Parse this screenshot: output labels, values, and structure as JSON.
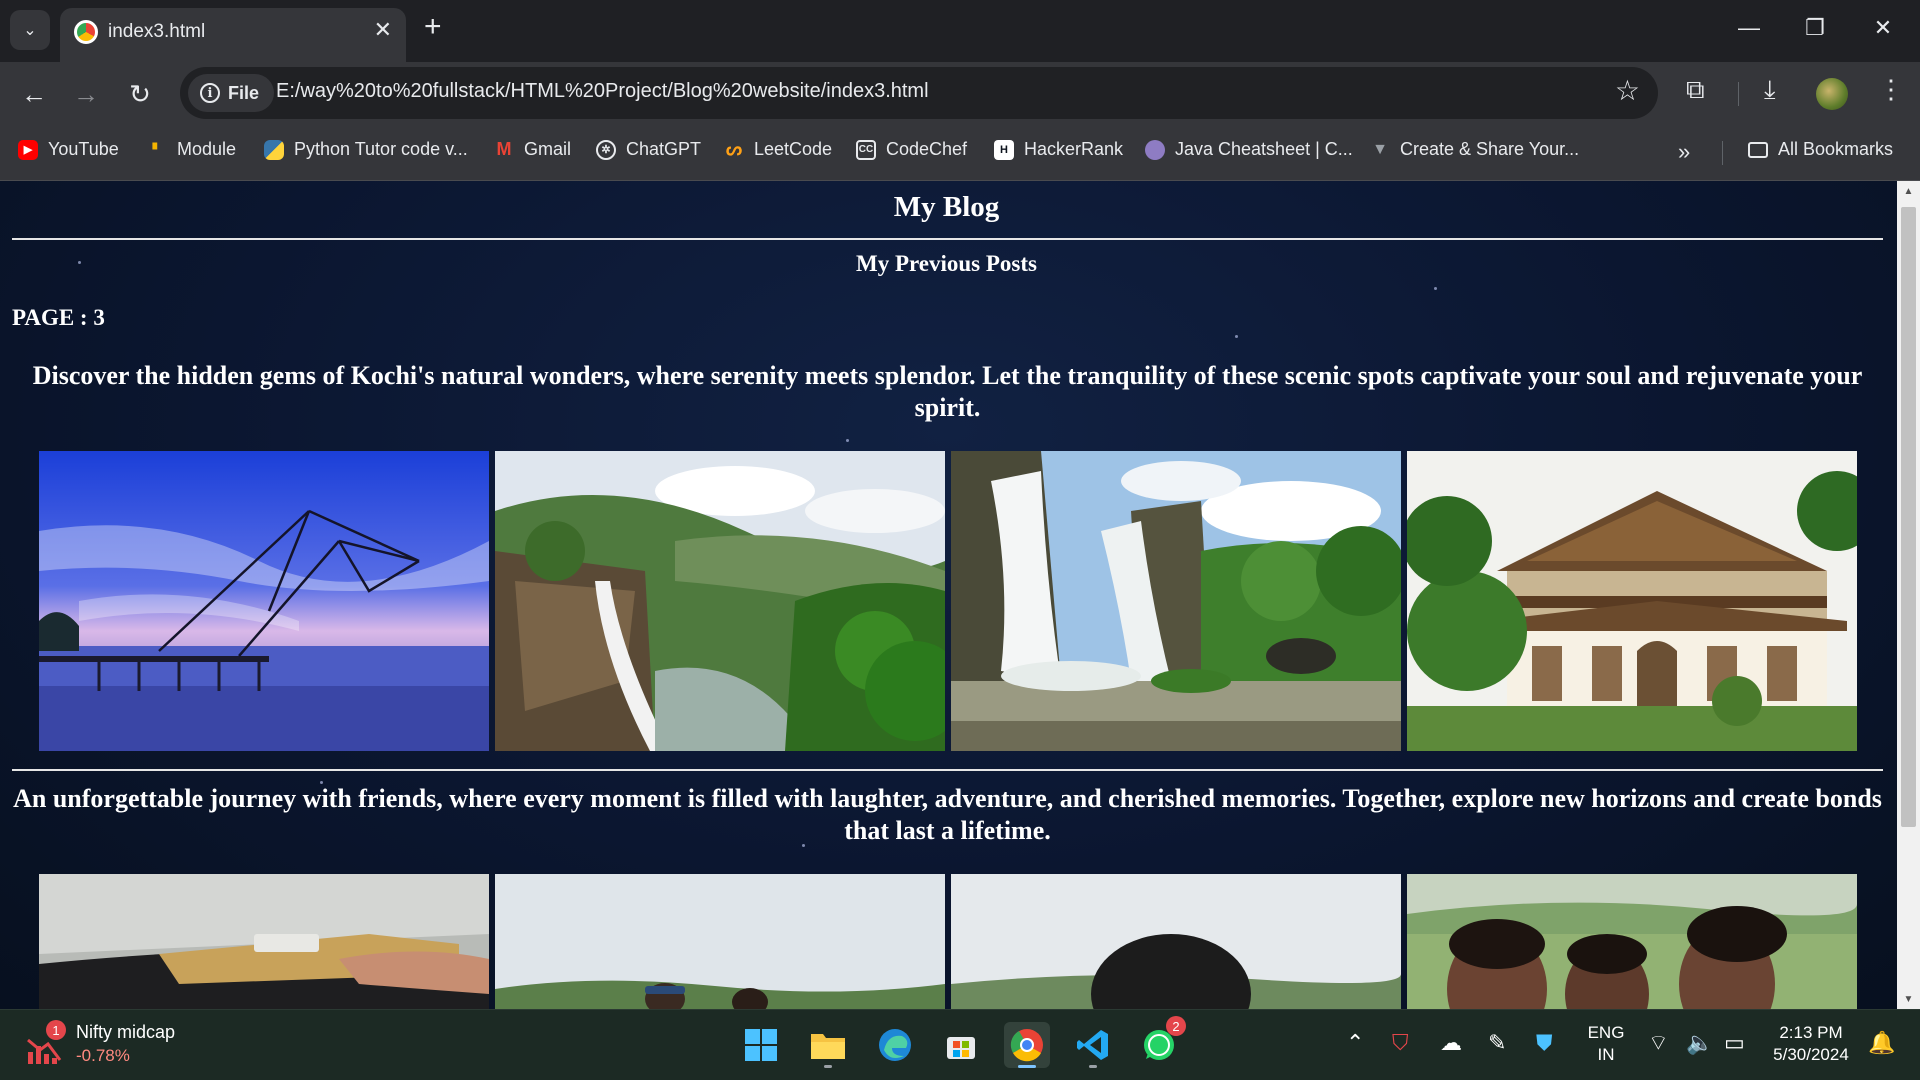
{
  "browser": {
    "tab": {
      "title": "index3.html"
    },
    "omnibox": {
      "chip": "File",
      "url": "E:/way%20to%20fullstack/HTML%20Project/Blog%20website/index3.html"
    },
    "bookmarks": [
      {
        "label": "YouTube",
        "icon": "youtube-icon",
        "color": "#ff0000"
      },
      {
        "label": "Module",
        "icon": "module-icon",
        "color": "#f4b400"
      },
      {
        "label": "Python Tutor code v...",
        "icon": "python-tutor-icon",
        "color": "#3776ab"
      },
      {
        "label": "Gmail",
        "icon": "gmail-icon",
        "color": "#ea4335"
      },
      {
        "label": "ChatGPT",
        "icon": "chatgpt-icon",
        "color": "#ffffff"
      },
      {
        "label": "LeetCode",
        "icon": "leetcode-icon",
        "color": "#ffa116"
      },
      {
        "label": "CodeChef",
        "icon": "codechef-icon",
        "color": "#5b4638"
      },
      {
        "label": "HackerRank",
        "icon": "hackerrank-icon",
        "color": "#1ba94c"
      },
      {
        "label": "Java Cheatsheet | C...",
        "icon": "java-cheatsheet-icon",
        "color": "#8e7cc3"
      },
      {
        "label": "Create & Share Your...",
        "icon": "create-share-icon",
        "color": "#9aa0a6"
      }
    ],
    "all_bookmarks": "All Bookmarks"
  },
  "page": {
    "blog_title": "My Blog",
    "section_title": "My Previous Posts",
    "page_label": "PAGE : 3",
    "posts": [
      {
        "text": "Discover the hidden gems of Kochi's natural wonders, where serenity meets splendor. Let the tranquility of these scenic spots captivate your soul and rejuvenate your spirit.",
        "photos": [
          "fishing-net-photo",
          "waterfall-valley-photo",
          "athirappilly-waterfall-photo",
          "heritage-palace-photo"
        ]
      },
      {
        "text": "An unforgettable journey with friends, where every moment is filled with laughter, adventure, and cherished memories. Together, explore new horizons and create bonds that last a lifetime.",
        "photos": [
          "car-interior-photo",
          "friends-hilltop-photo",
          "friend-back-photo",
          "friends-selfie-photo"
        ]
      }
    ]
  },
  "taskbar": {
    "widget": {
      "title": "Nifty midcap",
      "value": "-0.78%",
      "badge": "1"
    },
    "apps": [
      {
        "name": "start-icon"
      },
      {
        "name": "file-explorer-icon"
      },
      {
        "name": "edge-icon"
      },
      {
        "name": "store-icon"
      },
      {
        "name": "chrome-icon"
      },
      {
        "name": "vscode-icon"
      },
      {
        "name": "whatsapp-icon",
        "badge": "2"
      }
    ],
    "language": {
      "line1": "ENG",
      "line2": "IN"
    },
    "clock": {
      "time": "2:13 PM",
      "date": "5/30/2024"
    }
  }
}
